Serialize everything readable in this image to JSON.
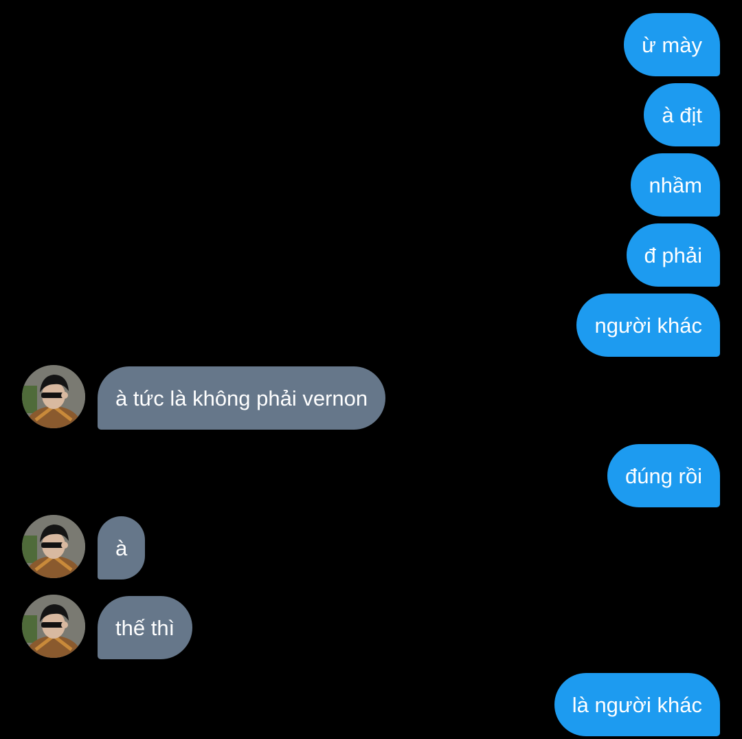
{
  "colors": {
    "background": "#000000",
    "sent_bubble": "#1d9bf0",
    "received_bubble": "#66778a",
    "text": "#ffffff"
  },
  "messages": [
    {
      "side": "sent",
      "text": "ừ mày"
    },
    {
      "side": "sent",
      "text": "à địt"
    },
    {
      "side": "sent",
      "text": "nhầm"
    },
    {
      "side": "sent",
      "text": "đ phải"
    },
    {
      "side": "sent",
      "text": "người khác"
    },
    {
      "side": "received",
      "text": "à tức là không phải vernon",
      "avatar": "contact-avatar-photo"
    },
    {
      "side": "sent",
      "text": "đúng rồi"
    },
    {
      "side": "received",
      "text": "à",
      "avatar": "contact-avatar-photo"
    },
    {
      "side": "received",
      "text": "thế thì",
      "avatar": "contact-avatar-photo"
    },
    {
      "side": "sent",
      "text": "là người khác"
    }
  ]
}
